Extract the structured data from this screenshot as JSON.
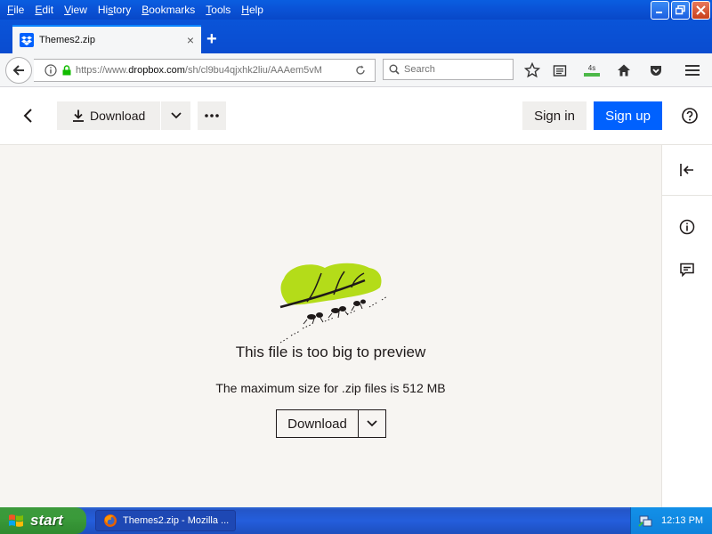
{
  "menubar": {
    "items": [
      {
        "pre": "",
        "u": "F",
        "post": "ile"
      },
      {
        "pre": "",
        "u": "E",
        "post": "dit"
      },
      {
        "pre": "",
        "u": "V",
        "post": "iew"
      },
      {
        "pre": "Hi",
        "u": "s",
        "post": "tory"
      },
      {
        "pre": "",
        "u": "B",
        "post": "ookmarks"
      },
      {
        "pre": "",
        "u": "T",
        "post": "ools"
      },
      {
        "pre": "",
        "u": "H",
        "post": "elp"
      }
    ]
  },
  "tab": {
    "title": "Themes2.zip",
    "close": "×",
    "new": "+"
  },
  "navbar": {
    "url_prefix": "https://www.",
    "url_domain": "dropbox.com",
    "url_path": "/sh/cl9bu4qjxhk2liu/AAAem5vM",
    "search_placeholder": "Search",
    "sync_badge": "4s"
  },
  "header": {
    "download_label": "Download",
    "signin_label": "Sign in",
    "signup_label": "Sign up"
  },
  "content": {
    "title": "This file is too big to preview",
    "subtitle": "The maximum size for .zip files is 512 MB",
    "download_label": "Download"
  },
  "taskbar": {
    "start_label": "start",
    "task_label": "Themes2.zip - Mozilla ...",
    "clock": "12:13 PM"
  },
  "colors": {
    "accent": "#0061fe",
    "xp_blue": "#0a54d8",
    "leaf_green": "#b4dc19"
  }
}
